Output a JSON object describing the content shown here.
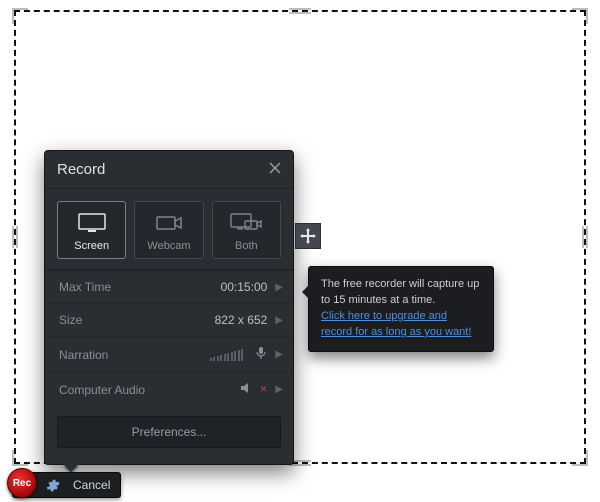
{
  "panel": {
    "title": "Record",
    "modes": [
      {
        "label": "Screen",
        "selected": true
      },
      {
        "label": "Webcam",
        "selected": false
      },
      {
        "label": "Both",
        "selected": false
      }
    ],
    "rows": {
      "max_time": {
        "label": "Max Time",
        "value": "00:15:00"
      },
      "size": {
        "label": "Size",
        "value": "822 x 652"
      },
      "narration": {
        "label": "Narration"
      },
      "computer_audio": {
        "label": "Computer Audio"
      }
    },
    "preferences_label": "Preferences..."
  },
  "tooltip": {
    "text": "The free recorder will capture up to 15 minutes at a time.",
    "link_text": "Click here to upgrade and record for as long as you want!"
  },
  "toolbar": {
    "rec_label": "Rec",
    "cancel_label": "Cancel"
  }
}
